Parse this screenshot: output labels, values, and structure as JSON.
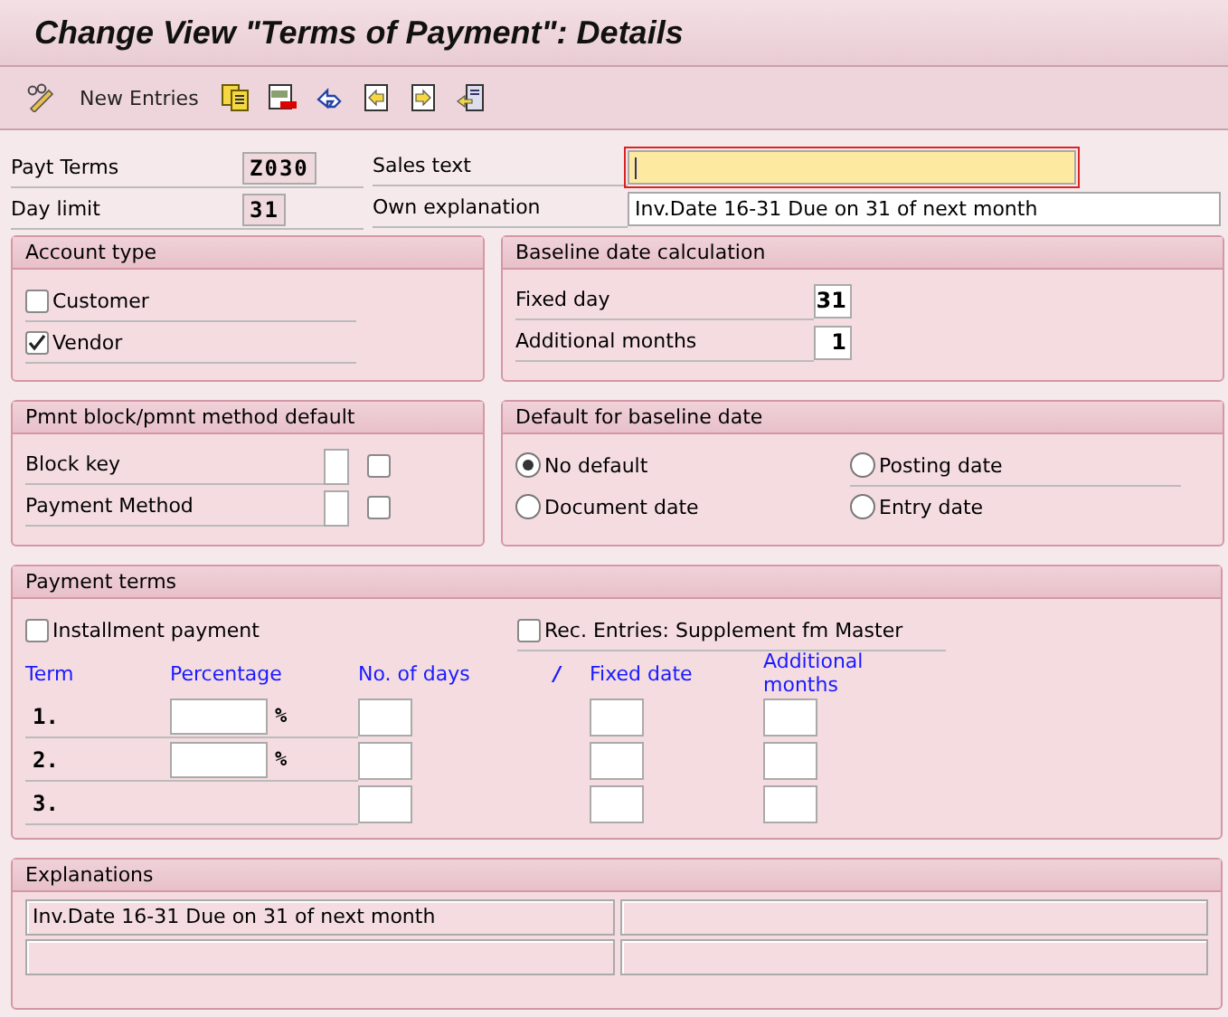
{
  "window": {
    "title": "Change View \"Terms of Payment\": Details"
  },
  "toolbar": {
    "button": "New Entries"
  },
  "header": [
    {
      "label": "Payt Terms",
      "value": "Z030",
      "kind": "code"
    },
    {
      "label": "Sales text",
      "kind": "text",
      "focused": true
    },
    {
      "label": "Day limit",
      "value": "31",
      "kind": "code"
    },
    {
      "label": "Own explanation",
      "value": "Inv.Date 16-31 Due on 31 of next month",
      "kind": "text",
      "focused": false
    }
  ],
  "account_type": {
    "title": "Account type",
    "options": [
      {
        "label": "Customer",
        "checked": false
      },
      {
        "label": "Vendor",
        "checked": true
      }
    ]
  },
  "baseline_calc": {
    "title": "Baseline date calculation",
    "fields": [
      {
        "label": "Fixed day",
        "value": "31"
      },
      {
        "label": "Additional months",
        "value": "1"
      }
    ]
  },
  "pmnt_block": {
    "title": "Pmnt block/pmnt method default",
    "fields": [
      {
        "label": "Block key",
        "checked": false
      },
      {
        "label": "Payment Method",
        "checked": false
      }
    ]
  },
  "default_baseline": {
    "title": "Default for baseline date",
    "options": [
      {
        "label": "No default",
        "selected": true
      },
      {
        "label": "Posting date",
        "selected": false
      },
      {
        "label": "Document date",
        "selected": false
      },
      {
        "label": "Entry date",
        "selected": false
      }
    ]
  },
  "payment_terms": {
    "title": "Payment terms",
    "checks": [
      {
        "label": "Installment payment",
        "checked": false
      },
      {
        "label": "Rec. Entries: Supplement fm Master",
        "checked": false
      }
    ],
    "columns": [
      "Term",
      "Percentage",
      "No. of days",
      "/",
      "Fixed date",
      "Additional months"
    ],
    "rows": [
      {
        "term": "1.",
        "unit": "%"
      },
      {
        "term": "2.",
        "unit": "%"
      },
      {
        "term": "3."
      }
    ]
  },
  "explanations": {
    "title": "Explanations",
    "lines": [
      "Inv.Date 16-31 Due on 31 of next month"
    ]
  }
}
